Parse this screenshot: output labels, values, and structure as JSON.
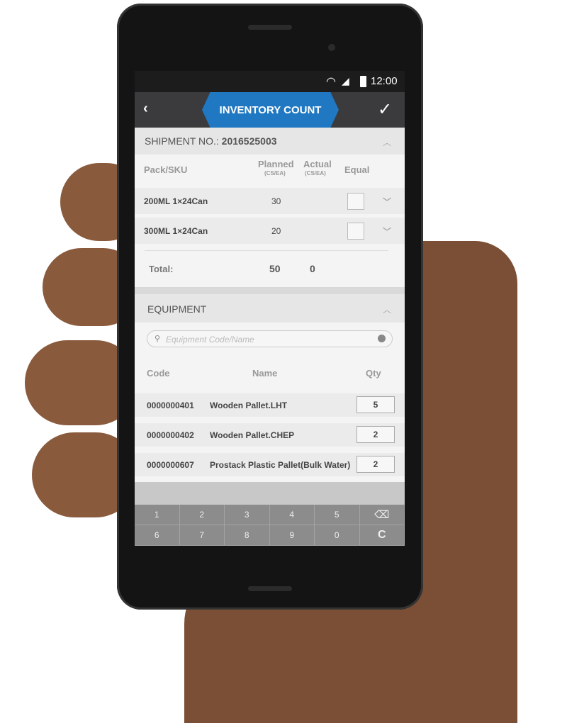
{
  "status_bar": {
    "time": "12:00",
    "icons": [
      "wifi-icon",
      "signal-icon",
      "battery-icon"
    ]
  },
  "header": {
    "title": "INVENTORY COUNT",
    "back_icon": "chevron-left-icon",
    "confirm_icon": "checkmark-icon",
    "accent": "#1f78c1"
  },
  "shipment": {
    "label": "SHIPMENT NO.:",
    "number": "2016525003",
    "columns": {
      "pack": "Pack/SKU",
      "planned": "Planned",
      "planned_unit": "(CS/EA)",
      "actual": "Actual",
      "actual_unit": "(CS/EA)",
      "equal": "Equal"
    },
    "rows": [
      {
        "sku": "200ML 1×24Can",
        "planned": "30",
        "actual": "",
        "equal": false
      },
      {
        "sku": "300ML 1×24Can",
        "planned": "20",
        "actual": "",
        "equal": false
      }
    ],
    "total": {
      "label": "Total:",
      "planned": "50",
      "actual": "0"
    }
  },
  "equipment": {
    "title": "EQUIPMENT",
    "search_placeholder": "Equipment Code/Name",
    "columns": {
      "code": "Code",
      "name": "Name",
      "qty": "Qty"
    },
    "rows": [
      {
        "code": "0000000401",
        "name": "Wooden Pallet.LHT",
        "qty": "5"
      },
      {
        "code": "0000000402",
        "name": "Wooden Pallet.CHEP",
        "qty": "2"
      },
      {
        "code": "0000000607",
        "name": "Prostack Plastic Pallet(Bulk Water)",
        "qty": "2"
      }
    ]
  },
  "keypad": {
    "keys": [
      "1",
      "2",
      "3",
      "4",
      "5",
      "⌫",
      "6",
      "7",
      "8",
      "9",
      "0",
      "C"
    ]
  }
}
